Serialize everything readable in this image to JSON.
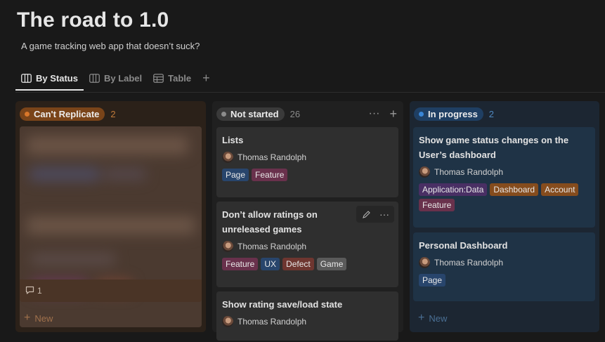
{
  "page": {
    "title": "The road to 1.0",
    "subtitle": "A game tracking web app that doesn’t suck?"
  },
  "tabs": [
    {
      "label": "By Status",
      "icon": "board-icon",
      "active": true
    },
    {
      "label": "By Label",
      "icon": "board-icon",
      "active": false
    },
    {
      "label": "Table",
      "icon": "table-icon",
      "active": false
    }
  ],
  "columns": [
    {
      "status": "Can't Replicate",
      "count": "2",
      "colors": {
        "pill": "#7a4419",
        "dot": "#d9772a",
        "count": "#c07a3a"
      },
      "blurred_card": {
        "comment_count": "1"
      },
      "new_label": "New"
    },
    {
      "status": "Not started",
      "count": "26",
      "colors": {
        "pill": "#3a3a3a",
        "dot": "#8c8c8c",
        "count": "#8a8a8a"
      },
      "cards": [
        {
          "title": "Lists",
          "assignee": "Thomas Randolph",
          "tags": [
            "Page",
            "Feature"
          ]
        },
        {
          "title": "Don’t allow ratings on unreleased games",
          "assignee": "Thomas Randolph",
          "tags": [
            "Feature",
            "UX",
            "Defect",
            "Game"
          ]
        },
        {
          "title": "Show rating save/load state",
          "assignee": "Thomas Randolph",
          "tags": []
        }
      ]
    },
    {
      "status": "In progress",
      "count": "2",
      "colors": {
        "pill": "#1f3f63",
        "dot": "#3a86d6",
        "count": "#4f88c0"
      },
      "cards": [
        {
          "title": "Show game status changes on the User’s dashboard",
          "assignee": "Thomas Randolph",
          "tags": [
            "Application:Data",
            "Dashboard",
            "Account",
            "Feature"
          ]
        },
        {
          "title": "Personal Dashboard",
          "assignee": "Thomas Randolph",
          "tags": [
            "Page"
          ]
        }
      ],
      "new_label": "New"
    }
  ]
}
